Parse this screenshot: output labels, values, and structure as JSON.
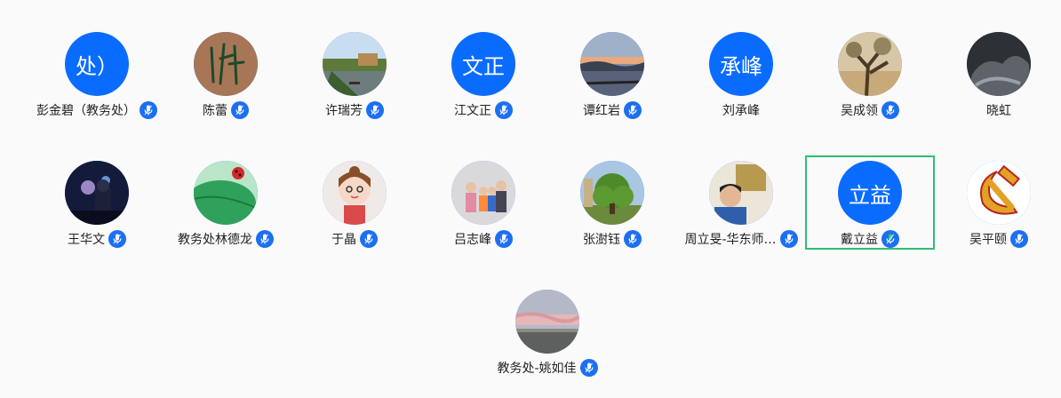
{
  "participants": [
    {
      "name": "彭金碧（教务处）",
      "avatar_type": "text",
      "avatar_text": "处）",
      "avatar_color": "#0a6cff",
      "mic": "on",
      "speaking": false
    },
    {
      "name": "陈蕾",
      "avatar_type": "image",
      "avatar_icon": "calligraphy-icon",
      "mic": "on",
      "speaking": false
    },
    {
      "name": "许瑞芳",
      "avatar_type": "image",
      "avatar_icon": "river-landscape-icon",
      "mic": "on",
      "speaking": false
    },
    {
      "name": "江文正",
      "avatar_type": "text",
      "avatar_text": "文正",
      "avatar_color": "#0a6cff",
      "mic": "on",
      "speaking": false
    },
    {
      "name": "谭红岩",
      "avatar_type": "image",
      "avatar_icon": "sunset-lake-icon",
      "mic": "on",
      "speaking": false
    },
    {
      "name": "刘承峰",
      "avatar_type": "text",
      "avatar_text": "承峰",
      "avatar_color": "#0a6cff",
      "mic": "none",
      "speaking": false
    },
    {
      "name": "吴成领",
      "avatar_type": "image",
      "avatar_icon": "desert-tree-icon",
      "mic": "on",
      "speaking": false
    },
    {
      "name": "晓虹",
      "avatar_type": "image",
      "avatar_icon": "dark-cloud-icon",
      "mic": "none",
      "speaking": false
    },
    {
      "name": "王华文",
      "avatar_type": "image",
      "avatar_icon": "night-scene-icon",
      "mic": "on",
      "speaking": false
    },
    {
      "name": "教务处林德龙",
      "avatar_type": "image",
      "avatar_icon": "ladybug-leaf-icon",
      "mic": "on",
      "speaking": false
    },
    {
      "name": "于晶",
      "avatar_type": "image",
      "avatar_icon": "cartoon-girl-icon",
      "mic": "on",
      "speaking": false
    },
    {
      "name": "吕志峰",
      "avatar_type": "image",
      "avatar_icon": "family-photo-icon",
      "mic": "on",
      "speaking": false
    },
    {
      "name": "张澍钰",
      "avatar_type": "image",
      "avatar_icon": "green-tree-icon",
      "mic": "on",
      "speaking": false
    },
    {
      "name": "周立旻-华东师…",
      "avatar_type": "image",
      "avatar_icon": "man-portrait-icon",
      "mic": "on",
      "speaking": false
    },
    {
      "name": "戴立益",
      "avatar_type": "text",
      "avatar_text": "立益",
      "avatar_color": "#0a6cff",
      "mic": "on",
      "speaking": true
    },
    {
      "name": "吴平颐",
      "avatar_type": "image",
      "avatar_icon": "hammer-sickle-icon",
      "mic": "on",
      "speaking": false
    },
    {
      "name": "教务处-姚如佳",
      "avatar_type": "image",
      "avatar_icon": "pink-sky-icon",
      "mic": "on",
      "speaking": false
    }
  ],
  "colors": {
    "avatar_blue": "#0a6cff",
    "mic_blue": "#1d6ff2",
    "mic_active_green": "#2fd45a",
    "active_border": "#2fbf71"
  }
}
